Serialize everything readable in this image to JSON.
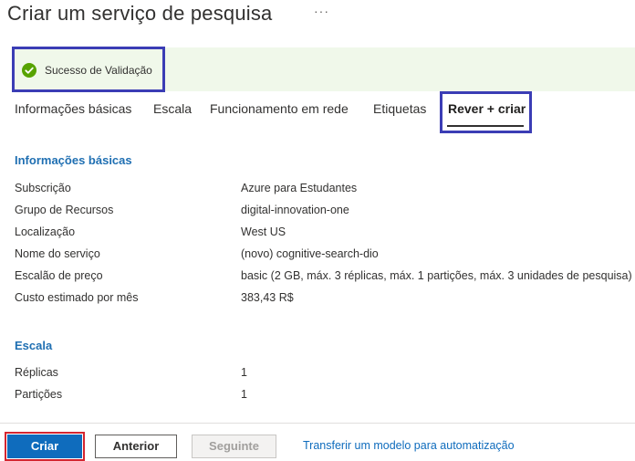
{
  "header": {
    "title": "Criar um serviço de pesquisa",
    "more_label": "···"
  },
  "banner": {
    "text": "Sucesso de Validação",
    "status_color": "#57a300"
  },
  "tabs": [
    {
      "label": "Informações básicas",
      "active": false
    },
    {
      "label": "Escala",
      "active": false
    },
    {
      "label": "Funcionamento em rede",
      "active": false
    },
    {
      "label": "Etiquetas",
      "active": false
    },
    {
      "label": "Rever + criar",
      "active": true
    }
  ],
  "basics": {
    "title": "Informações básicas",
    "rows": [
      {
        "label": "Subscrição",
        "value": "Azure para Estudantes"
      },
      {
        "label": "Grupo de Recursos",
        "value": "digital-innovation-one"
      },
      {
        "label": "Localização",
        "value": "West US"
      },
      {
        "label": "Nome do serviço",
        "value": "(novo) cognitive-search-dio"
      },
      {
        "label": "Escalão de preço",
        "value": "basic (2 GB, máx. 3 réplicas, máx. 1 partições, máx. 3 unidades de pesquisa)"
      },
      {
        "label": "Custo estimado por mês",
        "value": "383,43 R$"
      }
    ]
  },
  "scale": {
    "title": "Escala",
    "rows": [
      {
        "label": "Réplicas",
        "value": "1"
      },
      {
        "label": "Partições",
        "value": "1"
      }
    ]
  },
  "footer": {
    "create_label": "Criar",
    "previous_label": "Anterior",
    "next_label": "Seguinte",
    "download_link": "Transferir um modelo para automatização"
  }
}
